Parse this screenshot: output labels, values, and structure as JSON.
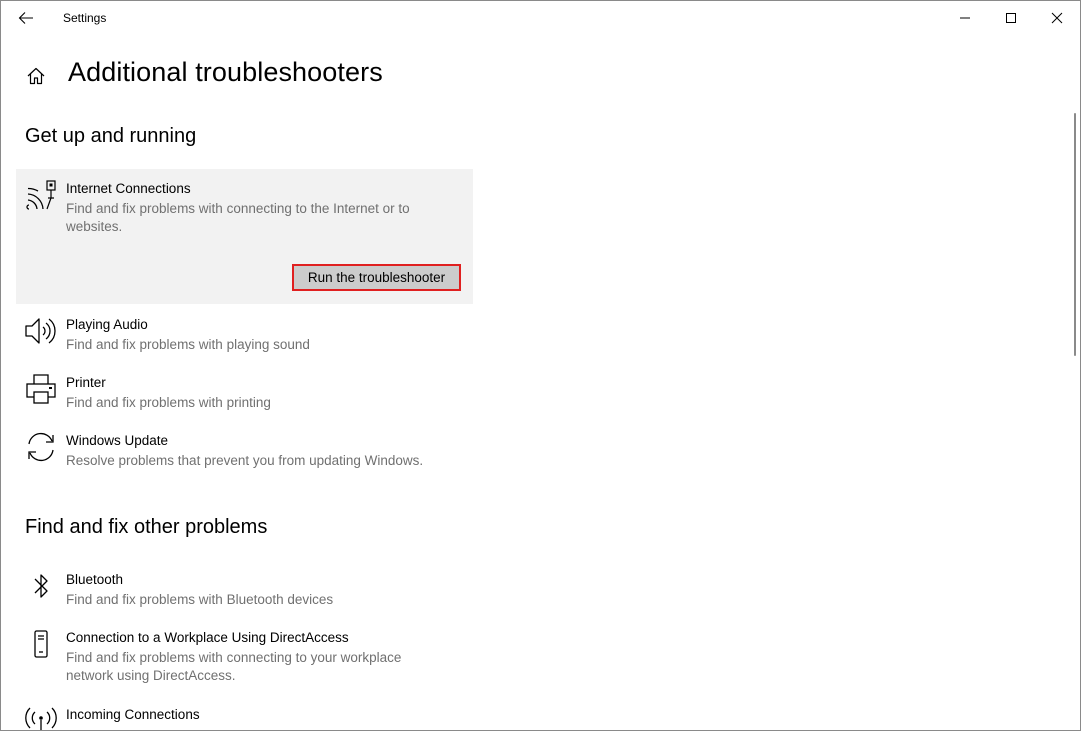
{
  "window": {
    "title": "Settings"
  },
  "page": {
    "title": "Additional troubleshooters"
  },
  "sections": [
    {
      "title": "Get up and running",
      "items": [
        {
          "name": "Internet Connections",
          "description": "Find and fix problems with connecting to the Internet or to websites.",
          "icon": "wifi-network-icon",
          "selected": true,
          "action_label": "Run the troubleshooter"
        },
        {
          "name": "Playing Audio",
          "description": "Find and fix problems with playing sound",
          "icon": "speaker-icon"
        },
        {
          "name": "Printer",
          "description": "Find and fix problems with printing",
          "icon": "printer-icon"
        },
        {
          "name": "Windows Update",
          "description": "Resolve problems that prevent you from updating Windows.",
          "icon": "sync-icon"
        }
      ]
    },
    {
      "title": "Find and fix other problems",
      "items": [
        {
          "name": "Bluetooth",
          "description": "Find and fix problems with Bluetooth devices",
          "icon": "bluetooth-icon"
        },
        {
          "name": "Connection to a Workplace Using DirectAccess",
          "description": "Find and fix problems with connecting to your workplace network using DirectAccess.",
          "icon": "phone-device-icon"
        },
        {
          "name": "Incoming Connections",
          "description": "",
          "icon": "broadcast-icon"
        }
      ]
    }
  ],
  "colors": {
    "highlight_border": "#e02020",
    "selected_bg": "#f2f2f2",
    "button_bg": "#cccccc",
    "secondary_text": "#707070"
  }
}
